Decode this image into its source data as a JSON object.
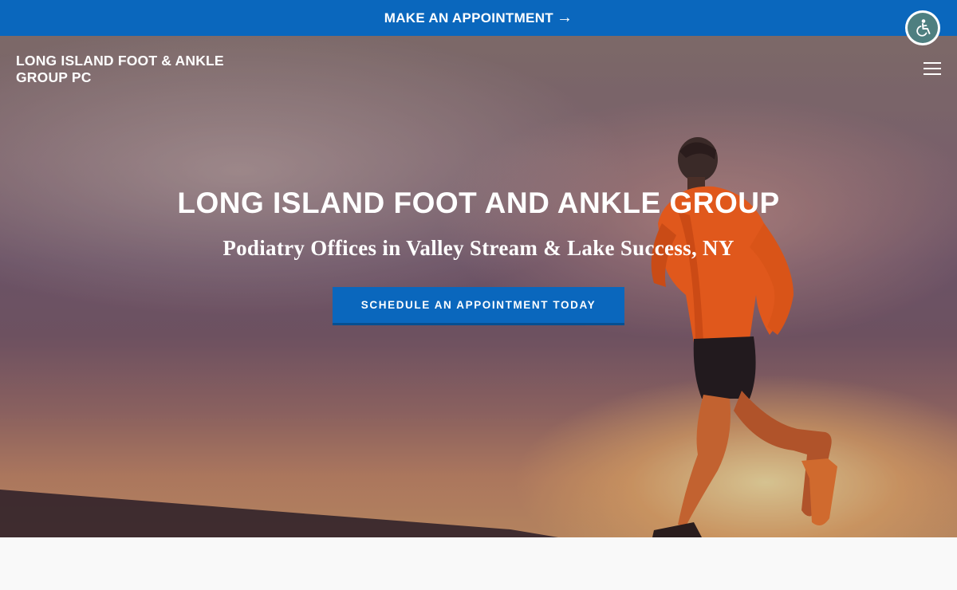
{
  "topbar": {
    "label": "MAKE AN APPOINTMENT",
    "arrow": "→"
  },
  "accessibility": {
    "icon": "accessibility-icon"
  },
  "header": {
    "logo_line1": "LONG ISLAND FOOT & ANKLE",
    "logo_line2": "GROUP PC",
    "menu_icon": "hamburger-menu-icon"
  },
  "hero": {
    "title": "LONG ISLAND FOOT AND ANKLE GROUP",
    "subtitle": "Podiatry Offices in Valley Stream & Lake Success, NY",
    "cta_label": "SCHEDULE AN APPOINTMENT TODAY",
    "image": "runner-at-sunset-photo"
  },
  "colors": {
    "brand_blue": "#0a67bd",
    "accessibility_teal": "#4e7f80"
  }
}
